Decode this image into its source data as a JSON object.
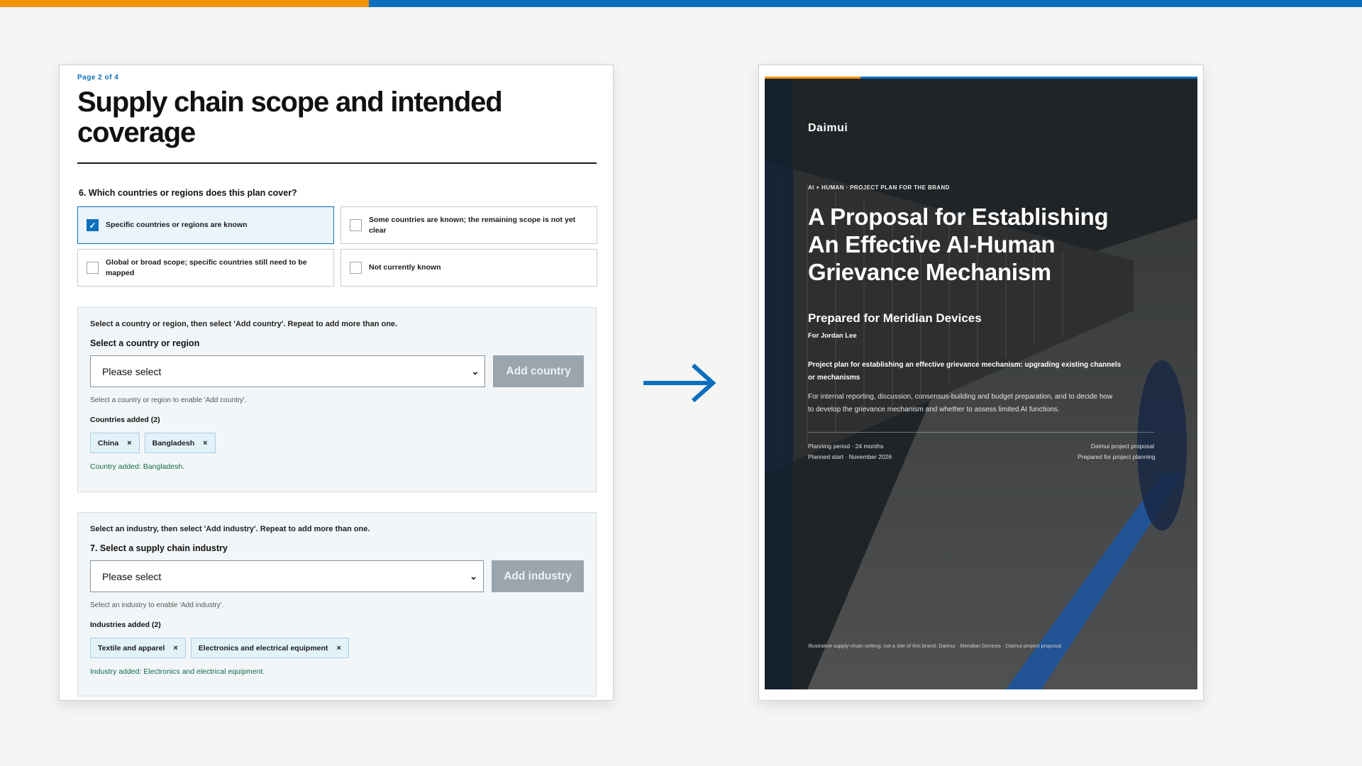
{
  "colors": {
    "accent_orange": "#f39200",
    "accent_blue": "#0b6fbd",
    "success_green": "#0e6b46",
    "disabled_button": "#9aa5ae"
  },
  "form": {
    "page_indicator": "Page 2 of 4",
    "title": "Supply chain scope and intended coverage",
    "question6": {
      "label": "6. Which countries or regions does this plan cover?",
      "options": [
        {
          "label": "Specific countries or regions are known",
          "checked": true
        },
        {
          "label": "Some countries are known; the remaining scope is not yet clear",
          "checked": false
        },
        {
          "label": "Global or broad scope; specific countries still need to be mapped",
          "checked": false
        },
        {
          "label": "Not currently known",
          "checked": false
        }
      ]
    },
    "country_panel": {
      "instruction": "Select a country or region, then select 'Add country'. Repeat to add more than one.",
      "select_label": "Select a country or region",
      "select_value": "Please select",
      "button_label": "Add country",
      "hint": "Select a country or region to enable 'Add country'.",
      "added_label": "Countries added (2)",
      "tags": [
        "China",
        "Bangladesh"
      ],
      "remove_symbol": "×",
      "confirmation": "Country added: Bangladesh."
    },
    "industry_panel": {
      "instruction": "Select an industry, then select 'Add industry'. Repeat to add more than one.",
      "select_label": "7. Select a supply chain industry",
      "select_value": "Please select",
      "button_label": "Add industry",
      "hint": "Select an industry to enable 'Add industry'.",
      "added_label": "Industries added (2)",
      "tags": [
        "Textile and apparel",
        "Electronics and electrical equipment"
      ],
      "remove_symbol": "×",
      "confirmation": "Industry added: Electronics and electrical equipment."
    }
  },
  "transition_icon": "arrow-right-icon",
  "cover": {
    "brand": "Daimui",
    "kicker": "AI + HUMAN · PROJECT PLAN FOR THE BRAND",
    "title": "A Proposal for Establishing An Effective AI-Human Grievance Mechanism",
    "prepared_for": "Prepared for Meridian Devices",
    "for_person": "For Jordan Lee",
    "plan_description": "Project plan for establishing an effective grievance mechanism: upgrading existing channels or mechanisms",
    "plan_body": "For internal reporting, discussion, consensus-building and budget preparation, and to decide how to develop the grievance mechanism and whether to assess limited AI functions.",
    "meta_left": [
      "Planning period · 24 months",
      "Planned start · November 2026"
    ],
    "meta_right": [
      "Daimui project proposal",
      "Prepared for project planning"
    ],
    "footnote": "Illustrative supply-chain setting; not a site of this brand. Daimui · Meridian Devices · Daimui project proposal"
  }
}
